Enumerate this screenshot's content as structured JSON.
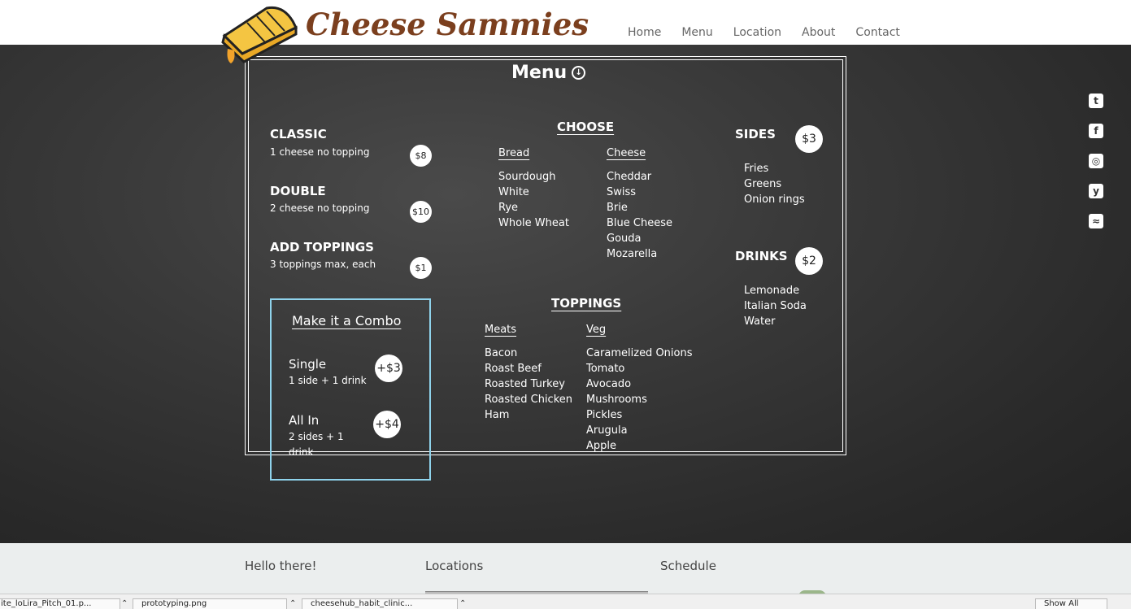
{
  "header": {
    "brand": "Cheese Sammies",
    "nav": [
      "Home",
      "Menu",
      "Location",
      "About",
      "Contact"
    ]
  },
  "board": {
    "title": "Menu",
    "classic": {
      "name": "CLASSIC",
      "desc": "1 cheese no topping",
      "price": "$8"
    },
    "double": {
      "name": "DOUBLE",
      "desc": "2 cheese no topping",
      "price": "$10"
    },
    "toppings_item": {
      "name": "ADD TOPPINGS",
      "desc": "3 toppings max, each",
      "price": "$1"
    },
    "combo": {
      "title": "Make it a Combo",
      "single": {
        "name": "Single",
        "desc": "1 side + 1 drink",
        "price": "+$3"
      },
      "allin": {
        "name": "All In",
        "desc1": "2 sides + 1",
        "desc2": "drink",
        "price": "+$4"
      }
    },
    "choose": {
      "title": "CHOOSE",
      "bread_label": "Bread",
      "bread": [
        "Sourdough",
        "White",
        "Rye",
        "Whole Wheat"
      ],
      "cheese_label": "Cheese",
      "cheese": [
        "Cheddar",
        "Swiss",
        "Brie",
        "Blue Cheese",
        "Gouda",
        "Mozarella"
      ]
    },
    "toppings": {
      "title": "TOPPINGS",
      "meats_label": "Meats",
      "meats": [
        "Bacon",
        "Roast Beef",
        "Roasted Turkey",
        "Roasted Chicken",
        "Ham"
      ],
      "veg_label": "Veg",
      "veg": [
        "Caramelized Onions",
        "Tomato",
        "Avocado",
        "Mushrooms",
        "Pickles",
        "Arugula",
        "Apple"
      ]
    },
    "sides": {
      "title": "SIDES",
      "price": "$3",
      "items": [
        "Fries",
        "Greens",
        "Onion rings"
      ]
    },
    "drinks": {
      "title": "DRINKS",
      "price": "$2",
      "items": [
        "Lemonade",
        "Italian Soda",
        "Water"
      ]
    }
  },
  "social": [
    "twitter-icon",
    "facebook-icon",
    "instagram-icon",
    "yelp-icon",
    "rss-icon"
  ],
  "footer": {
    "col1": "Hello there!",
    "col2": "Locations",
    "col3": "Schedule"
  },
  "taskbar": {
    "item1": "ite_loLira_Pitch_01.p...",
    "item2": "prototyping.png",
    "item3": "cheesehub_habit_clinic...",
    "show_all": "Show All"
  }
}
